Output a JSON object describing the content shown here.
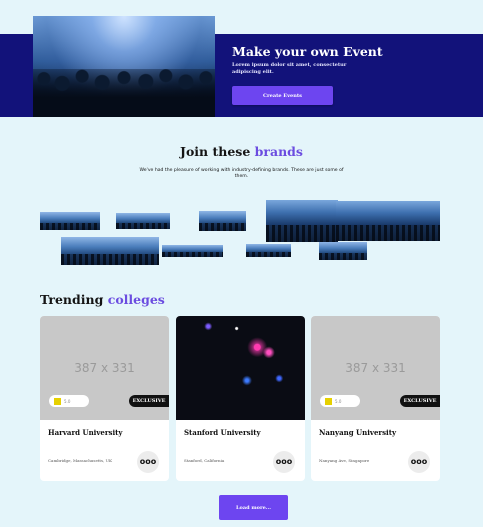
{
  "hero": {
    "title": "Make your own Event",
    "text": "Lorem ipsum dolor sit amet, consectetur adipiscing elit.",
    "button_label": "Create Events"
  },
  "brands": {
    "title_plain": "Join these",
    "title_accent": "brands",
    "subtitle": "We've had the pleasure of working with industry-defining brands. These are just some of them."
  },
  "colleges": {
    "title_plain": "Trending",
    "title_accent": "colleges",
    "placeholder_text": "387 x 331",
    "cards": [
      {
        "name": "Harvard University",
        "location": "Cambridge, Massachusetts, UK",
        "badge": "EXCLUSIVE",
        "rating": "5.0"
      },
      {
        "name": "Stanford University",
        "location": "Stanford, California",
        "badge": "",
        "rating": ""
      },
      {
        "name": "Nanyang University",
        "location": "Nanyang Ave, Singapore",
        "badge": "EXCLUSIVE",
        "rating": "5.0"
      }
    ],
    "more_icon": "ooo",
    "load_more_label": "Load more..."
  },
  "colors": {
    "hero_band": "#12127a",
    "accent": "#6b4ce0",
    "button": "#6d45f0",
    "background": "#e4f5fa"
  }
}
